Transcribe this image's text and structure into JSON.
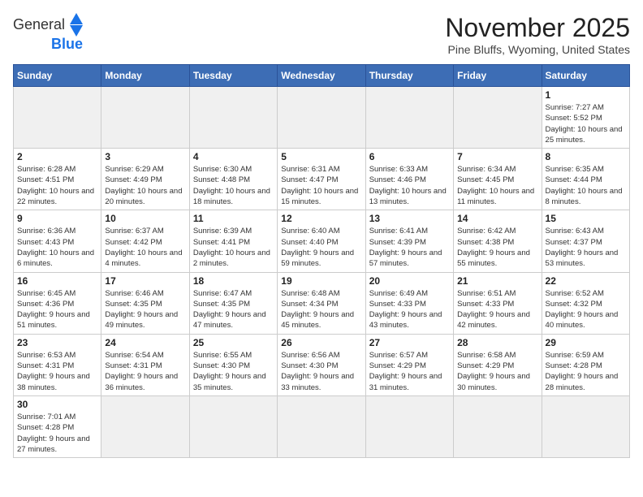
{
  "header": {
    "logo_line1": "General",
    "logo_line2": "Blue",
    "month_title": "November 2025",
    "location": "Pine Bluffs, Wyoming, United States"
  },
  "weekdays": [
    "Sunday",
    "Monday",
    "Tuesday",
    "Wednesday",
    "Thursday",
    "Friday",
    "Saturday"
  ],
  "weeks": [
    [
      {
        "day": "",
        "info": ""
      },
      {
        "day": "",
        "info": ""
      },
      {
        "day": "",
        "info": ""
      },
      {
        "day": "",
        "info": ""
      },
      {
        "day": "",
        "info": ""
      },
      {
        "day": "",
        "info": ""
      },
      {
        "day": "1",
        "info": "Sunrise: 7:27 AM\nSunset: 5:52 PM\nDaylight: 10 hours and 25 minutes."
      }
    ],
    [
      {
        "day": "2",
        "info": "Sunrise: 6:28 AM\nSunset: 4:51 PM\nDaylight: 10 hours and 22 minutes."
      },
      {
        "day": "3",
        "info": "Sunrise: 6:29 AM\nSunset: 4:49 PM\nDaylight: 10 hours and 20 minutes."
      },
      {
        "day": "4",
        "info": "Sunrise: 6:30 AM\nSunset: 4:48 PM\nDaylight: 10 hours and 18 minutes."
      },
      {
        "day": "5",
        "info": "Sunrise: 6:31 AM\nSunset: 4:47 PM\nDaylight: 10 hours and 15 minutes."
      },
      {
        "day": "6",
        "info": "Sunrise: 6:33 AM\nSunset: 4:46 PM\nDaylight: 10 hours and 13 minutes."
      },
      {
        "day": "7",
        "info": "Sunrise: 6:34 AM\nSunset: 4:45 PM\nDaylight: 10 hours and 11 minutes."
      },
      {
        "day": "8",
        "info": "Sunrise: 6:35 AM\nSunset: 4:44 PM\nDaylight: 10 hours and 8 minutes."
      }
    ],
    [
      {
        "day": "9",
        "info": "Sunrise: 6:36 AM\nSunset: 4:43 PM\nDaylight: 10 hours and 6 minutes."
      },
      {
        "day": "10",
        "info": "Sunrise: 6:37 AM\nSunset: 4:42 PM\nDaylight: 10 hours and 4 minutes."
      },
      {
        "day": "11",
        "info": "Sunrise: 6:39 AM\nSunset: 4:41 PM\nDaylight: 10 hours and 2 minutes."
      },
      {
        "day": "12",
        "info": "Sunrise: 6:40 AM\nSunset: 4:40 PM\nDaylight: 9 hours and 59 minutes."
      },
      {
        "day": "13",
        "info": "Sunrise: 6:41 AM\nSunset: 4:39 PM\nDaylight: 9 hours and 57 minutes."
      },
      {
        "day": "14",
        "info": "Sunrise: 6:42 AM\nSunset: 4:38 PM\nDaylight: 9 hours and 55 minutes."
      },
      {
        "day": "15",
        "info": "Sunrise: 6:43 AM\nSunset: 4:37 PM\nDaylight: 9 hours and 53 minutes."
      }
    ],
    [
      {
        "day": "16",
        "info": "Sunrise: 6:45 AM\nSunset: 4:36 PM\nDaylight: 9 hours and 51 minutes."
      },
      {
        "day": "17",
        "info": "Sunrise: 6:46 AM\nSunset: 4:35 PM\nDaylight: 9 hours and 49 minutes."
      },
      {
        "day": "18",
        "info": "Sunrise: 6:47 AM\nSunset: 4:35 PM\nDaylight: 9 hours and 47 minutes."
      },
      {
        "day": "19",
        "info": "Sunrise: 6:48 AM\nSunset: 4:34 PM\nDaylight: 9 hours and 45 minutes."
      },
      {
        "day": "20",
        "info": "Sunrise: 6:49 AM\nSunset: 4:33 PM\nDaylight: 9 hours and 43 minutes."
      },
      {
        "day": "21",
        "info": "Sunrise: 6:51 AM\nSunset: 4:33 PM\nDaylight: 9 hours and 42 minutes."
      },
      {
        "day": "22",
        "info": "Sunrise: 6:52 AM\nSunset: 4:32 PM\nDaylight: 9 hours and 40 minutes."
      }
    ],
    [
      {
        "day": "23",
        "info": "Sunrise: 6:53 AM\nSunset: 4:31 PM\nDaylight: 9 hours and 38 minutes."
      },
      {
        "day": "24",
        "info": "Sunrise: 6:54 AM\nSunset: 4:31 PM\nDaylight: 9 hours and 36 minutes."
      },
      {
        "day": "25",
        "info": "Sunrise: 6:55 AM\nSunset: 4:30 PM\nDaylight: 9 hours and 35 minutes."
      },
      {
        "day": "26",
        "info": "Sunrise: 6:56 AM\nSunset: 4:30 PM\nDaylight: 9 hours and 33 minutes."
      },
      {
        "day": "27",
        "info": "Sunrise: 6:57 AM\nSunset: 4:29 PM\nDaylight: 9 hours and 31 minutes."
      },
      {
        "day": "28",
        "info": "Sunrise: 6:58 AM\nSunset: 4:29 PM\nDaylight: 9 hours and 30 minutes."
      },
      {
        "day": "29",
        "info": "Sunrise: 6:59 AM\nSunset: 4:28 PM\nDaylight: 9 hours and 28 minutes."
      }
    ],
    [
      {
        "day": "30",
        "info": "Sunrise: 7:01 AM\nSunset: 4:28 PM\nDaylight: 9 hours and 27 minutes."
      },
      {
        "day": "",
        "info": ""
      },
      {
        "day": "",
        "info": ""
      },
      {
        "day": "",
        "info": ""
      },
      {
        "day": "",
        "info": ""
      },
      {
        "day": "",
        "info": ""
      },
      {
        "day": "",
        "info": ""
      }
    ]
  ]
}
